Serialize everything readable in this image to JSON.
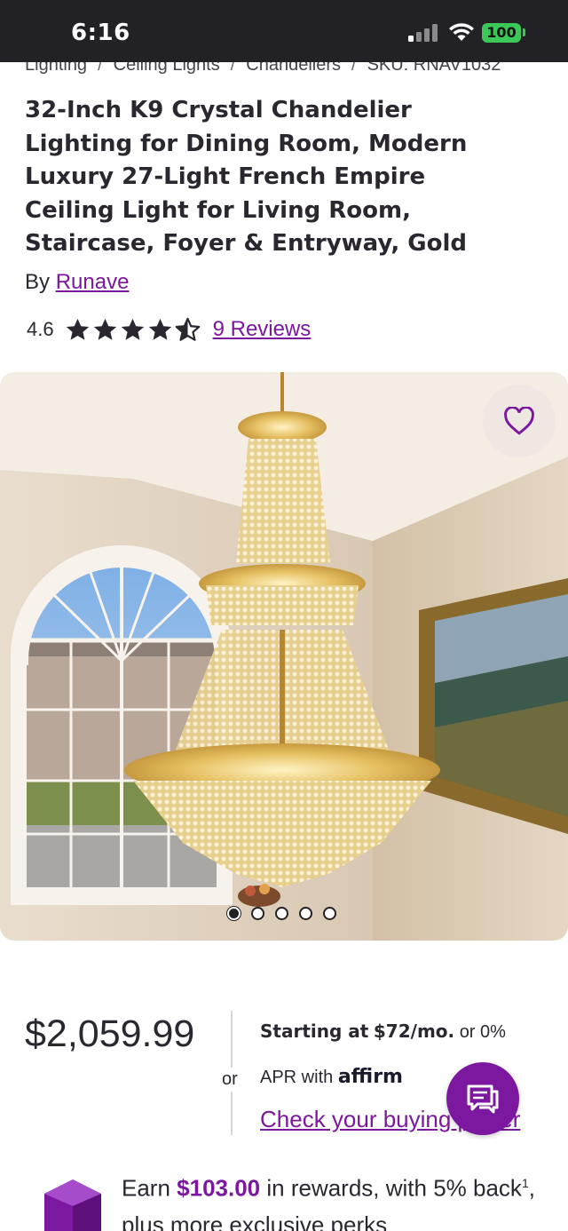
{
  "status_bar": {
    "time": "6:16",
    "battery": "100"
  },
  "breadcrumb": {
    "items": [
      "Lighting",
      "Ceiling Lights",
      "Chandeliers"
    ],
    "sku": "SKU: RNAV1032"
  },
  "product": {
    "title": "32-Inch K9 Crystal Chandelier Lighting for Dining Room, Modern Luxury 27-Light French Empire Ceiling Light for Living Room, Staircase, Foyer & Entryway, Gold",
    "by_label": "By",
    "brand": "Runave",
    "rating": "4.6",
    "rating_value": 4.6,
    "rating_max": 5,
    "reviews_label": "9 Reviews"
  },
  "gallery": {
    "image_count": 5,
    "active_index": 0,
    "image_icon": "crystal-chandelier-photo",
    "favorite_icon": "heart-icon"
  },
  "pricing": {
    "price": "$2,059.99",
    "or_label": "or",
    "starting_at_label": "Starting at",
    "monthly": "$72/mo.",
    "zero_label": "or 0%",
    "apr_label": "APR with",
    "affirm_label": "affirm",
    "check_link": "Check your buying power"
  },
  "chat": {
    "icon": "chat-bubble-icon"
  },
  "rewards": {
    "earn_label": "Earn",
    "amount": "$103.00",
    "text_after": " in rewards, with 5% back",
    "superscript": "1",
    "text_end": ", plus more exclusive perks"
  },
  "colors": {
    "accent": "#7b189f",
    "status_bar_bg": "#222226",
    "battery_green": "#3bc859",
    "text": "#2b2730"
  }
}
